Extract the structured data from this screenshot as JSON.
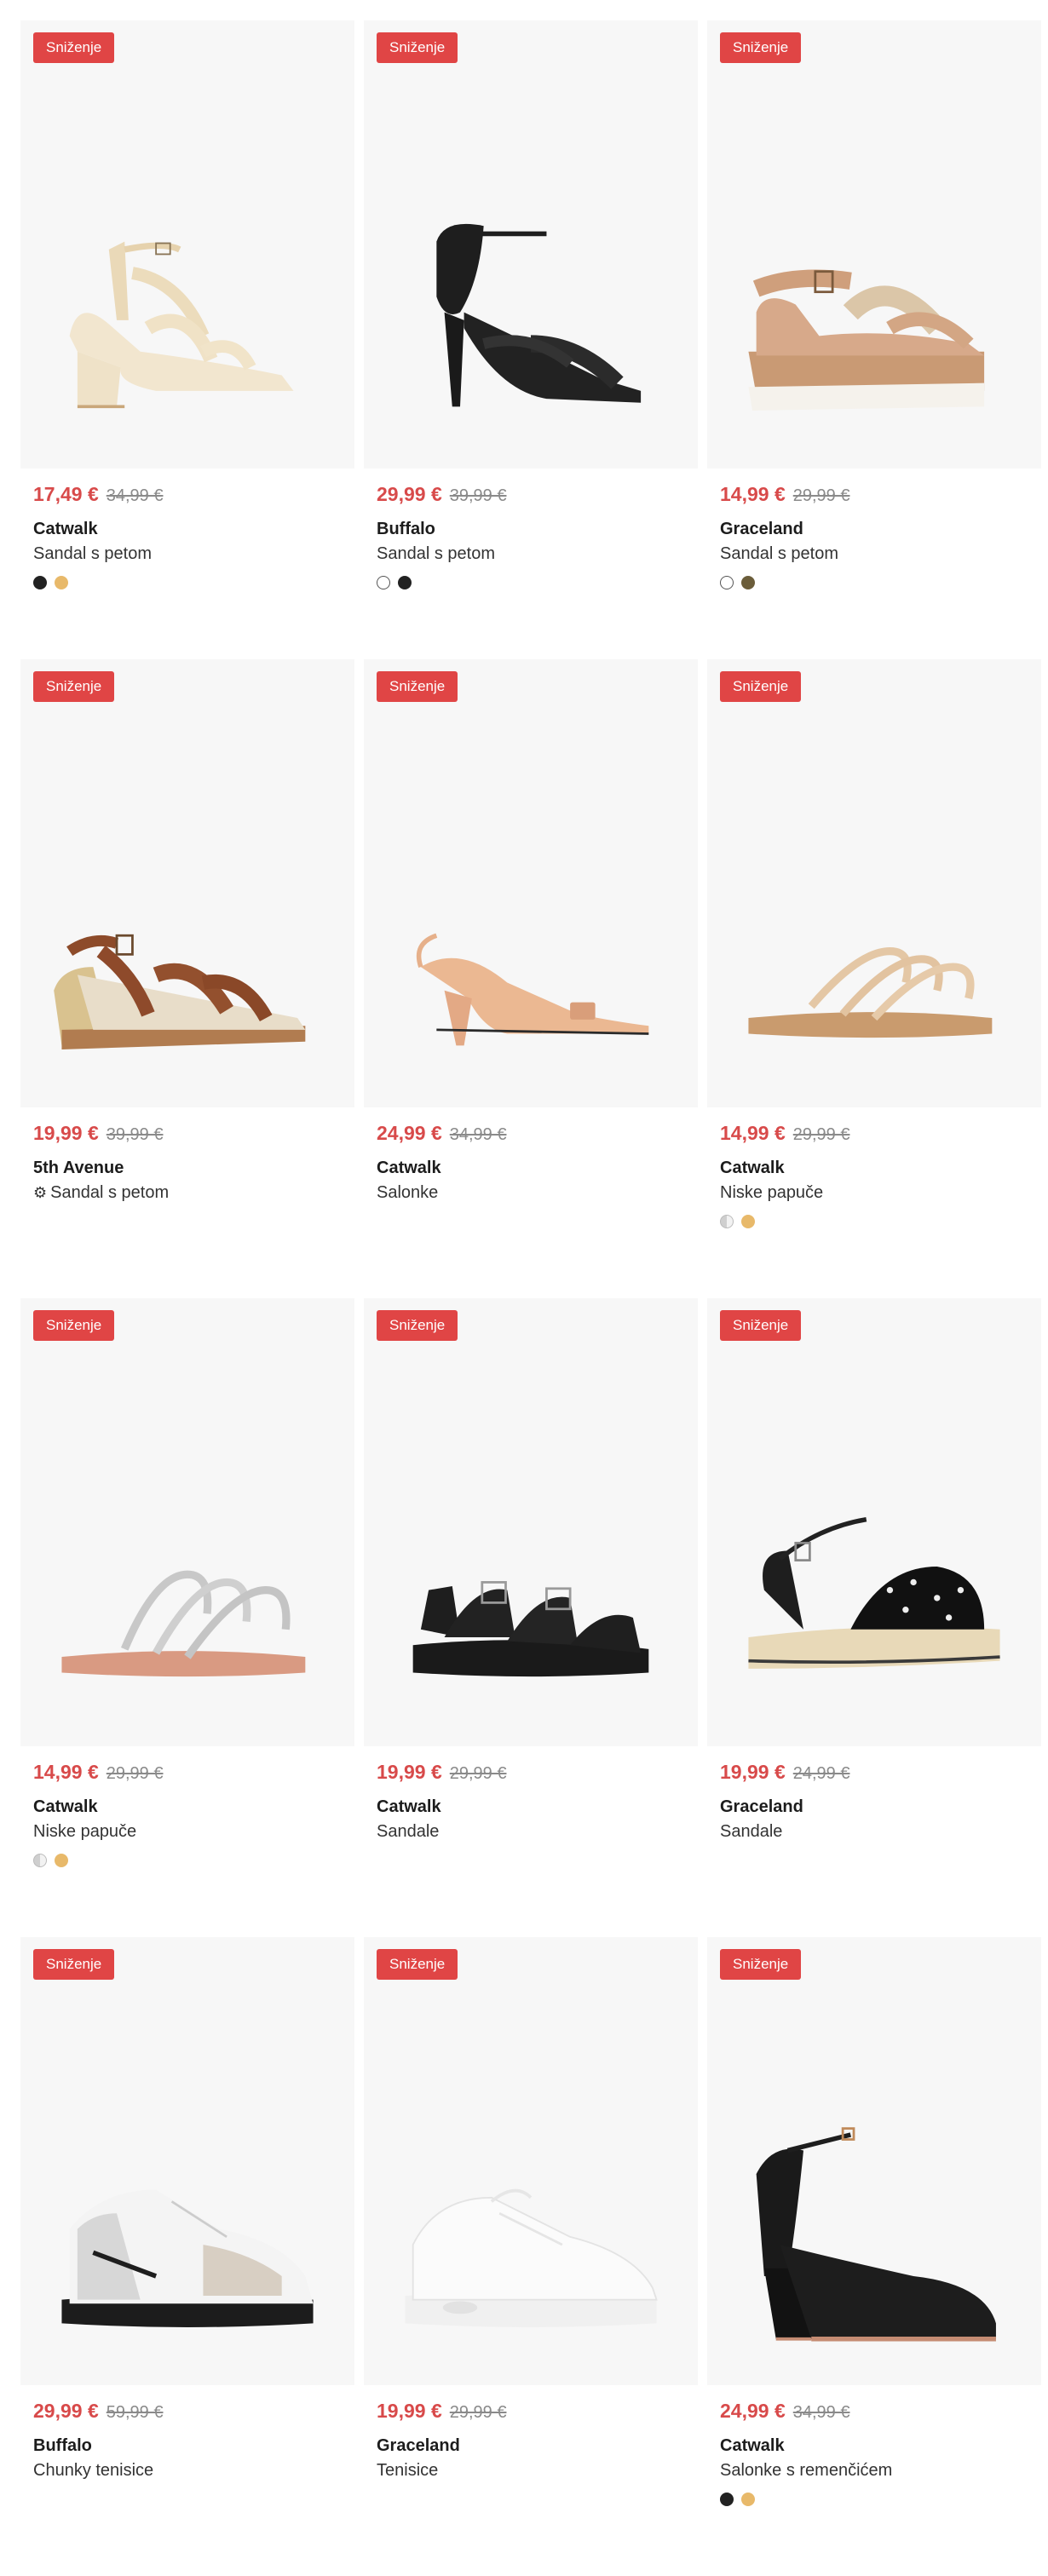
{
  "badge_label": "Sniženje",
  "colors": {
    "accent": "#e04545",
    "sale_price": "#d84a4a",
    "card_bg": "#f7f7f7"
  },
  "products": [
    {
      "price_new": "17,49 €",
      "price_old": "34,99 €",
      "brand": "Catwalk",
      "name": "Sandal s petom",
      "icon": "",
      "swatches": [
        "#222222",
        "#e8b96a"
      ],
      "shoe": "block-sandal-cream"
    },
    {
      "price_new": "29,99 €",
      "price_old": "39,99 €",
      "brand": "Buffalo",
      "name": "Sandal s petom",
      "icon": "",
      "swatches": [
        "white",
        "#222222"
      ],
      "shoe": "stiletto-sandal-black"
    },
    {
      "price_new": "14,99 €",
      "price_old": "29,99 €",
      "brand": "Graceland",
      "name": "Sandal s petom",
      "icon": "",
      "swatches": [
        "white",
        "#6b5d3a"
      ],
      "shoe": "platform-sandal-tan"
    },
    {
      "price_new": "19,99 €",
      "price_old": "39,99 €",
      "brand": "5th Avenue",
      "name": "Sandal s petom",
      "icon": "gear-icon",
      "swatches": [],
      "shoe": "wedge-sandal-brown"
    },
    {
      "price_new": "24,99 €",
      "price_old": "34,99 €",
      "brand": "Catwalk",
      "name": "Salonke",
      "icon": "",
      "swatches": [],
      "shoe": "slingback-pump-nude"
    },
    {
      "price_new": "14,99 €",
      "price_old": "29,99 €",
      "brand": "Catwalk",
      "name": "Niske papuče",
      "icon": "",
      "swatches": [
        "silver",
        "#e8b96a"
      ],
      "shoe": "flat-slide-gold"
    },
    {
      "price_new": "14,99 €",
      "price_old": "29,99 €",
      "brand": "Catwalk",
      "name": "Niske papuče",
      "icon": "",
      "swatches": [
        "silver",
        "#e8b96a"
      ],
      "shoe": "flat-slide-silver"
    },
    {
      "price_new": "19,99 €",
      "price_old": "29,99 €",
      "brand": "Catwalk",
      "name": "Sandale",
      "icon": "",
      "swatches": [],
      "shoe": "buckle-sandal-black"
    },
    {
      "price_new": "19,99 €",
      "price_old": "24,99 €",
      "brand": "Graceland",
      "name": "Sandale",
      "icon": "",
      "swatches": [],
      "shoe": "espadrille-sandal"
    },
    {
      "price_new": "29,99 €",
      "price_old": "59,99 €",
      "brand": "Buffalo",
      "name": "Chunky tenisice",
      "icon": "",
      "swatches": [],
      "shoe": "chunky-sneaker"
    },
    {
      "price_new": "19,99 €",
      "price_old": "29,99 €",
      "brand": "Graceland",
      "name": "Tenisice",
      "icon": "",
      "swatches": [],
      "shoe": "white-sneaker"
    },
    {
      "price_new": "24,99 €",
      "price_old": "34,99 €",
      "brand": "Catwalk",
      "name": "Salonke s remenčićem",
      "icon": "",
      "swatches": [
        "#222222",
        "#e8b96a"
      ],
      "shoe": "platform-pump-black"
    }
  ]
}
